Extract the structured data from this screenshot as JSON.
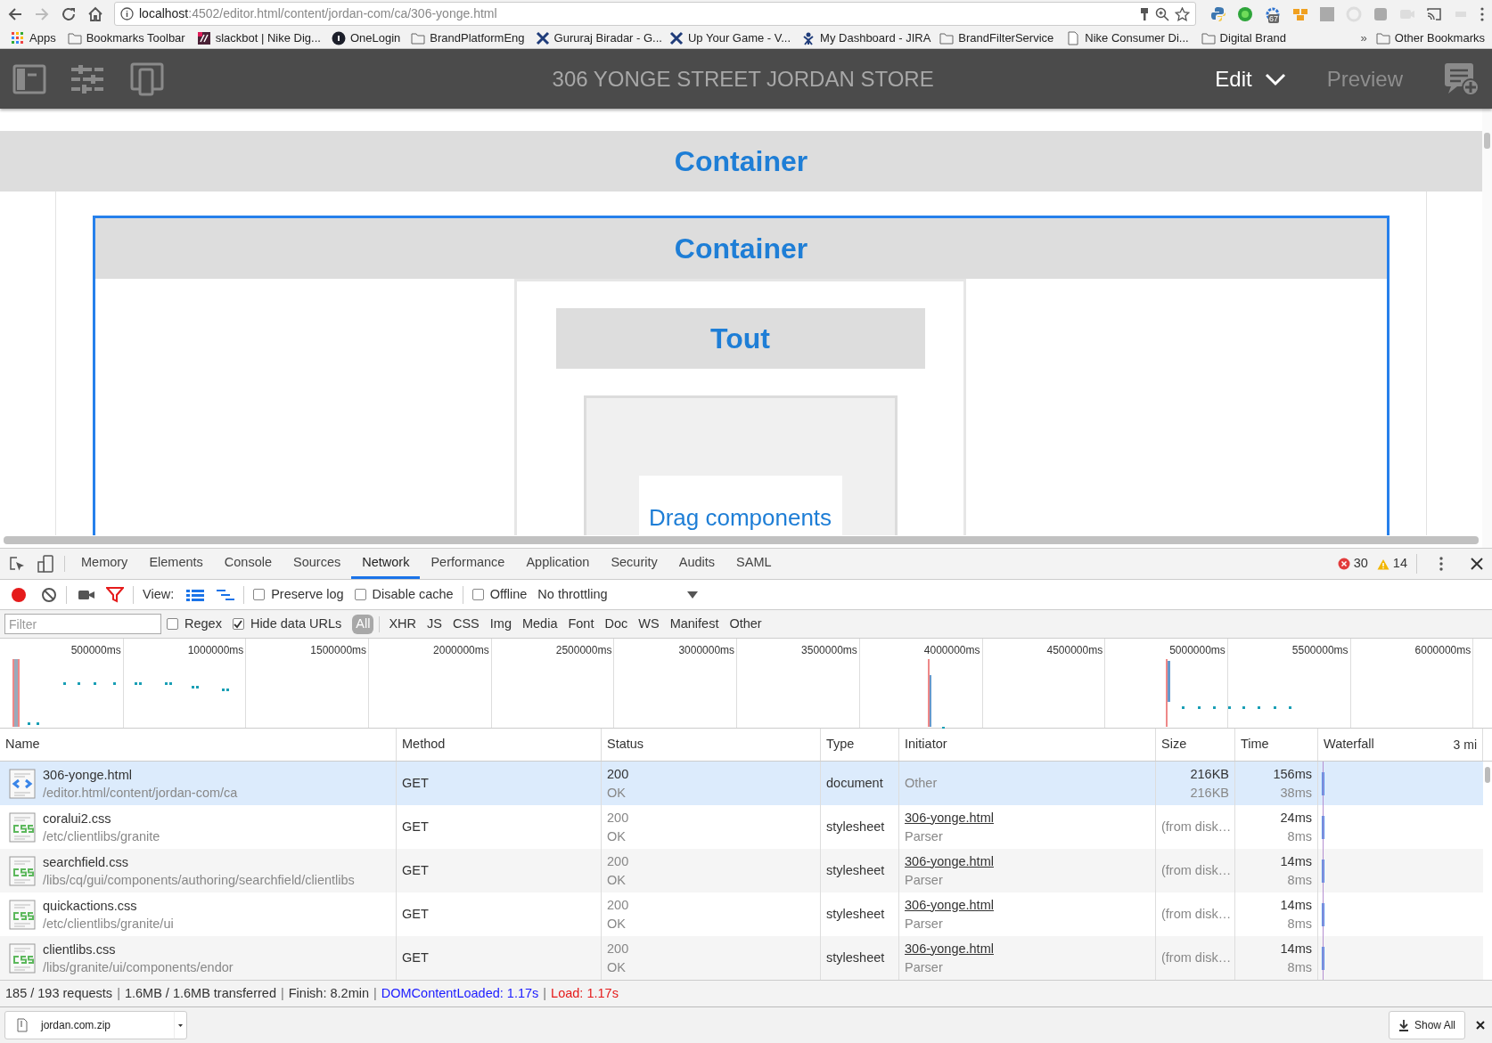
{
  "browser": {
    "url_host": "localhost",
    "url_path": ":4502/editor.html/content/jordan-com/ca/306-yonge.html",
    "extension_badge": "67",
    "bookmarks": [
      {
        "label": "Apps",
        "kind": "apps"
      },
      {
        "label": "Bookmarks Toolbar",
        "kind": "folder"
      },
      {
        "label": "slackbot | Nike Dig...",
        "kind": "slack"
      },
      {
        "label": "OneLogin",
        "kind": "onelogin"
      },
      {
        "label": "BrandPlatformEng",
        "kind": "folder"
      },
      {
        "label": "Gururaj Biradar - G...",
        "kind": "jira"
      },
      {
        "label": "Up Your Game - V...",
        "kind": "jira"
      },
      {
        "label": "My Dashboard - JIRA",
        "kind": "jira2"
      },
      {
        "label": "BrandFilterService",
        "kind": "folder"
      },
      {
        "label": "Nike Consumer Di...",
        "kind": "page"
      },
      {
        "label": "Digital Brand",
        "kind": "folder"
      }
    ],
    "overflow": "»",
    "other_bookmarks": "Other Bookmarks"
  },
  "editor_header": {
    "title": "306 YONGE STREET JORDAN STORE",
    "mode": "Edit",
    "preview": "Preview"
  },
  "canvas": {
    "outer_title": "Container",
    "inner_title": "Container",
    "tout": "Tout",
    "placeholder": "Drag components"
  },
  "devtools": {
    "tabs": [
      {
        "label": "Memory",
        "selected": false
      },
      {
        "label": "Elements",
        "selected": false
      },
      {
        "label": "Console",
        "selected": false
      },
      {
        "label": "Sources",
        "selected": false
      },
      {
        "label": "Network",
        "selected": true
      },
      {
        "label": "Performance",
        "selected": false
      },
      {
        "label": "Application",
        "selected": false
      },
      {
        "label": "Security",
        "selected": false
      },
      {
        "label": "Audits",
        "selected": false
      },
      {
        "label": "SAML",
        "selected": false
      }
    ],
    "errors": "30",
    "warnings": "14",
    "toolbar": {
      "recording": true,
      "view_label": "View:",
      "large_rows": true,
      "options": [
        {
          "label": "Preserve log",
          "checked": false
        },
        {
          "label": "Disable cache",
          "checked": false
        },
        {
          "label": "Offline",
          "checked": false
        }
      ],
      "throttling": "No throttling"
    },
    "filter": {
      "placeholder": "Filter",
      "options": [
        {
          "label": "Regex",
          "checked": false
        },
        {
          "label": "Hide data URLs",
          "checked": true
        }
      ],
      "types": [
        {
          "label": "All",
          "selected": true
        },
        {
          "label": "XHR",
          "selected": false
        },
        {
          "label": "JS",
          "selected": false
        },
        {
          "label": "CSS",
          "selected": false
        },
        {
          "label": "Img",
          "selected": false
        },
        {
          "label": "Media",
          "selected": false
        },
        {
          "label": "Font",
          "selected": false
        },
        {
          "label": "Doc",
          "selected": false
        },
        {
          "label": "WS",
          "selected": false
        },
        {
          "label": "Manifest",
          "selected": false
        },
        {
          "label": "Other",
          "selected": false
        }
      ]
    },
    "timeline_ticks": [
      "500000ms",
      "1000000ms",
      "1500000ms",
      "2000000ms",
      "2500000ms",
      "3000000ms",
      "3500000ms",
      "4000000ms",
      "4500000ms",
      "5000000ms",
      "5500000ms",
      "6000000ms"
    ],
    "columns": [
      "Name",
      "Method",
      "Status",
      "Type",
      "Initiator",
      "Size",
      "Time",
      "Waterfall"
    ],
    "waterfall_scale": "3 mi",
    "rows": [
      {
        "kind": "html",
        "name": "306-yonge.html",
        "path": "/editor.html/content/jordan-com/ca",
        "method": "GET",
        "status": "200",
        "status_text": "OK",
        "type": "document",
        "initiator": "Other",
        "initiator_detail": "",
        "size": "216KB",
        "size_detail": "216KB",
        "time": "156ms",
        "latency": "38ms",
        "cached": false,
        "selected": true
      },
      {
        "kind": "css",
        "name": "coralui2.css",
        "path": "/etc/clientlibs/granite",
        "method": "GET",
        "status": "200",
        "status_text": "OK",
        "type": "stylesheet",
        "initiator": "306-yonge.html",
        "initiator_detail": "Parser",
        "size": "(from disk…",
        "time": "24ms",
        "latency": "8ms",
        "cached": true,
        "selected": false
      },
      {
        "kind": "css",
        "name": "searchfield.css",
        "path": "/libs/cq/gui/components/authoring/searchfield/clientlibs",
        "method": "GET",
        "status": "200",
        "status_text": "OK",
        "type": "stylesheet",
        "initiator": "306-yonge.html",
        "initiator_detail": "Parser",
        "size": "(from disk…",
        "time": "14ms",
        "latency": "8ms",
        "cached": true,
        "selected": false
      },
      {
        "kind": "css",
        "name": "quickactions.css",
        "path": "/etc/clientlibs/granite/ui",
        "method": "GET",
        "status": "200",
        "status_text": "OK",
        "type": "stylesheet",
        "initiator": "306-yonge.html",
        "initiator_detail": "Parser",
        "size": "(from disk…",
        "time": "14ms",
        "latency": "8ms",
        "cached": true,
        "selected": false
      },
      {
        "kind": "css",
        "name": "clientlibs.css",
        "path": "/libs/granite/ui/components/endor",
        "method": "GET",
        "status": "200",
        "status_text": "OK",
        "type": "stylesheet",
        "initiator": "306-yonge.html",
        "initiator_detail": "Parser",
        "size": "(from disk…",
        "time": "14ms",
        "latency": "8ms",
        "cached": true,
        "selected": false
      }
    ],
    "summary": [
      {
        "kind": "plain",
        "text": "185 / 193 requests"
      },
      {
        "kind": "sep",
        "text": "|"
      },
      {
        "kind": "plain",
        "text": "1.6MB / 1.6MB transferred"
      },
      {
        "kind": "sep",
        "text": "|"
      },
      {
        "kind": "plain",
        "text": "Finish: 8.2min"
      },
      {
        "kind": "sep",
        "text": "|"
      },
      {
        "kind": "dom",
        "text": "DOMContentLoaded: 1.17s"
      },
      {
        "kind": "sep",
        "text": "|"
      },
      {
        "kind": "load",
        "text": "Load: 1.17s"
      }
    ]
  },
  "downloads": {
    "file": "jordan.com.zip",
    "show_all": "Show All"
  }
}
